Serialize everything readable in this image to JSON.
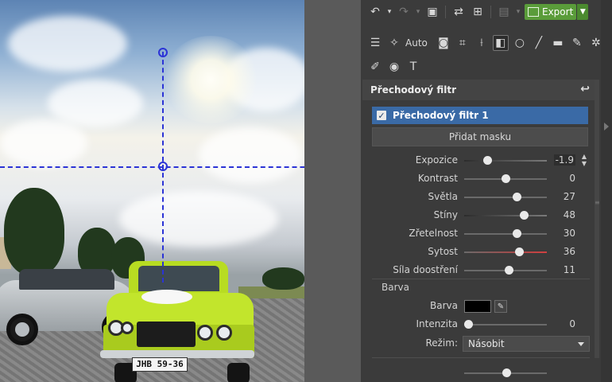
{
  "toolbar": {
    "row1": [
      {
        "name": "undo-icon",
        "glyph": "↶"
      },
      {
        "name": "undo-dropdown-icon",
        "glyph": "▾"
      },
      {
        "name": "redo-icon",
        "glyph": "↷"
      },
      {
        "name": "redo-dropdown-icon",
        "glyph": "▾"
      },
      {
        "name": "image-icon",
        "glyph": "▣"
      },
      {
        "name": "compare-icon",
        "glyph": "⇄"
      },
      {
        "name": "history-icon",
        "glyph": "⊞"
      },
      {
        "name": "save-icon",
        "glyph": "💾"
      },
      {
        "name": "save-dropdown-icon",
        "glyph": "▾"
      }
    ],
    "export_label": "Export",
    "auto_label": "Auto"
  },
  "panel": {
    "title": "Přechodový filtr",
    "filter_name": "Přechodový filtr 1",
    "filter_checked": true,
    "add_mask_label": "Přidat masku",
    "sliders": [
      {
        "label": "Expozice",
        "value": "-1.9",
        "fraction": 0.28,
        "track": "dark",
        "spin": true
      },
      {
        "label": "Kontrast",
        "value": "0",
        "fraction": 0.5,
        "track": "plain"
      },
      {
        "label": "Světla",
        "value": "27",
        "fraction": 0.63,
        "track": "plain"
      },
      {
        "label": "Stíny",
        "value": "48",
        "fraction": 0.72,
        "track": "dark"
      },
      {
        "label": "Zřetelnost",
        "value": "30",
        "fraction": 0.63,
        "track": "plain"
      },
      {
        "label": "Sytost",
        "value": "36",
        "fraction": 0.66,
        "track": "red"
      },
      {
        "label": "Síla doostření",
        "value": "11",
        "fraction": 0.54,
        "track": "plain"
      }
    ],
    "color_section_title": "Barva",
    "color_label": "Barva",
    "color_value": "#000000",
    "intensity_label": "Intenzita",
    "intensity_value": "0",
    "intensity_fraction": 0.0,
    "mode_label": "Režim:",
    "mode_value": "Násobit"
  },
  "photo": {
    "plate_text": "JHB 59-36"
  },
  "colors": {
    "panel_bg": "#3b3b3b",
    "selection_blue": "#3a6aa6",
    "export_green": "#5a9c3a",
    "guide_blue": "#2b33d6"
  }
}
